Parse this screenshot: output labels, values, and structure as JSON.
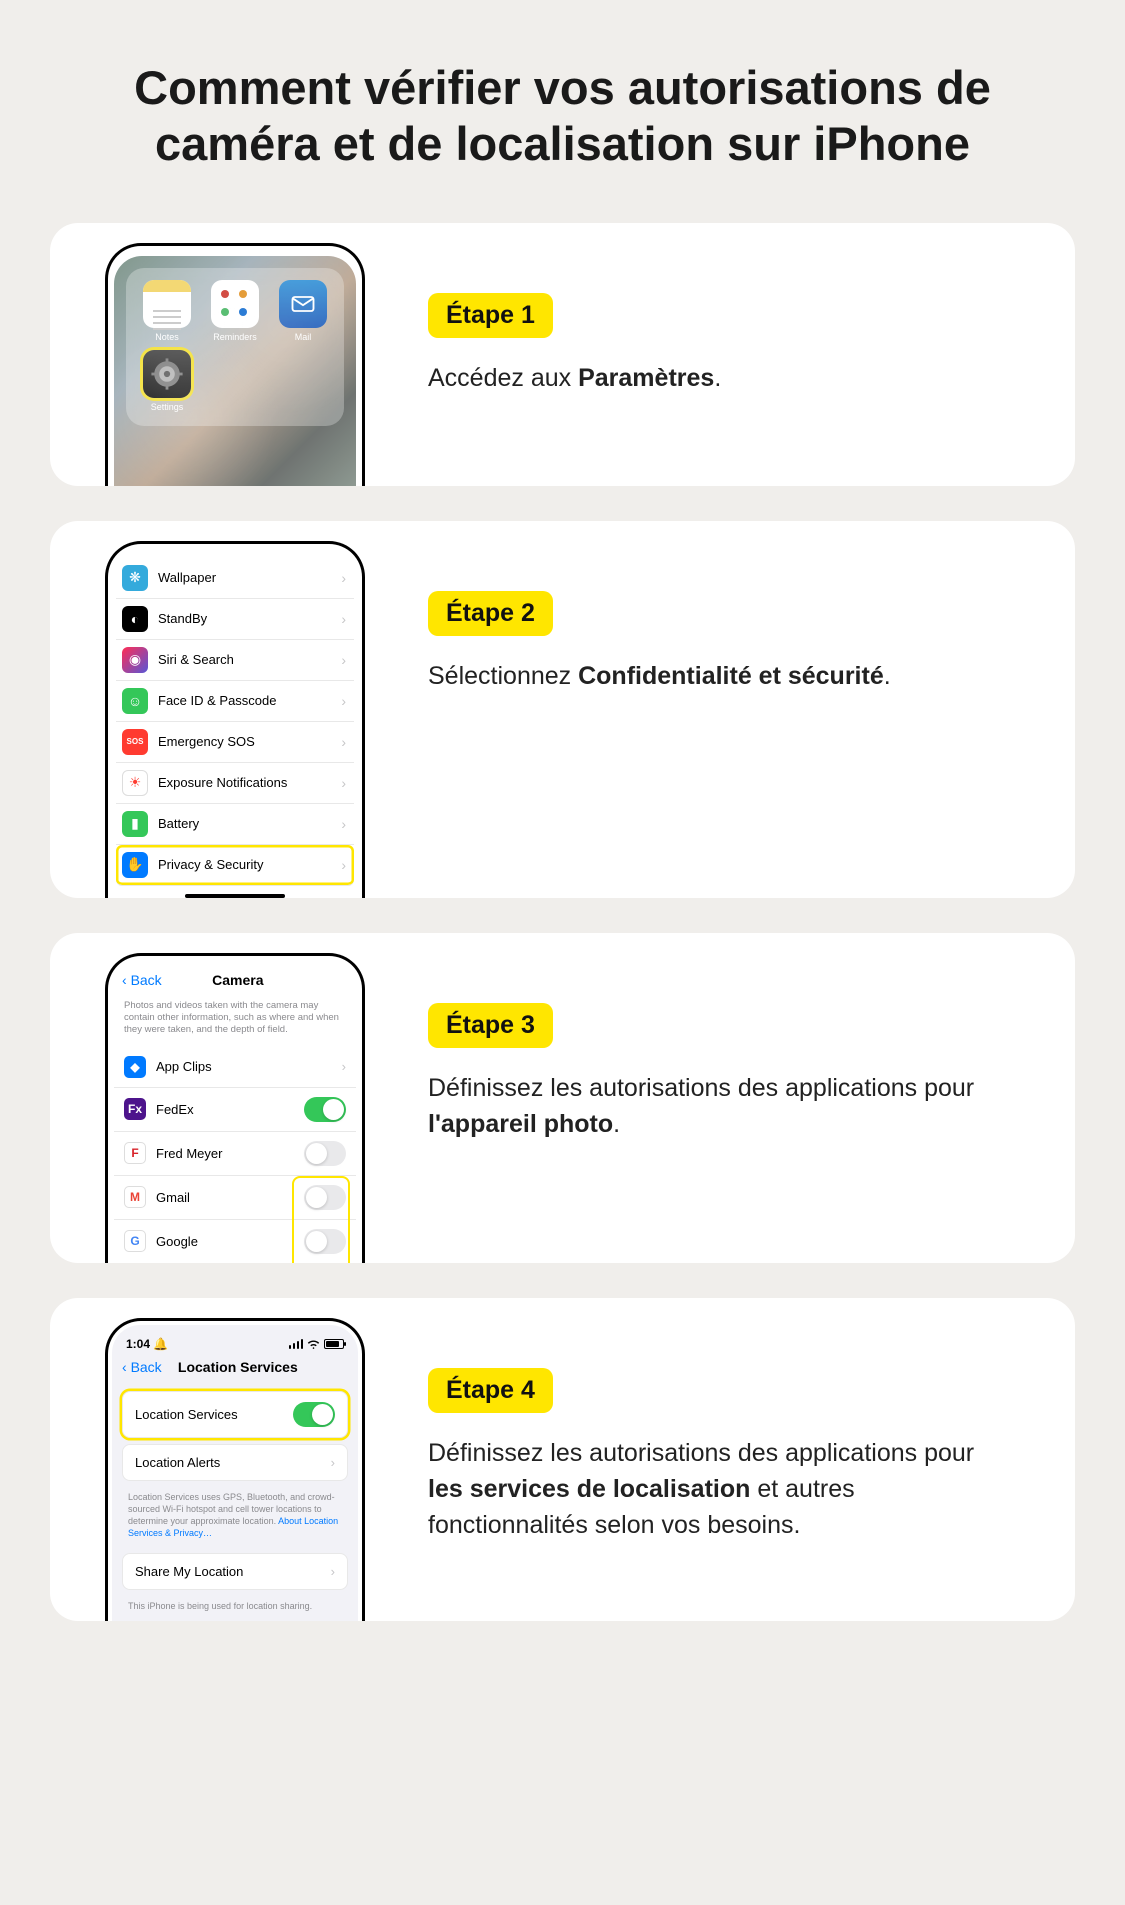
{
  "title": "Comment vérifier vos autorisations de caméra et de localisation sur iPhone",
  "steps": [
    {
      "badge": "Étape 1",
      "desc_pre": "Accédez aux ",
      "desc_bold": "Paramètres",
      "desc_post": ".",
      "home_apps": {
        "notes": "Notes",
        "reminders": "Reminders",
        "mail": "Mail",
        "settings": "Settings"
      }
    },
    {
      "badge": "Étape 2",
      "desc_pre": "Sélectionnez ",
      "desc_bold": "Confidentialité et sécurité",
      "desc_post": ".",
      "rows": [
        {
          "label": "Wallpaper",
          "color": "#34aadc",
          "glyph": "❋"
        },
        {
          "label": "StandBy",
          "color": "#000",
          "glyph": "◐"
        },
        {
          "label": "Siri & Search",
          "color": "linear-gradient(135deg,#ff2d55,#5856d6)",
          "glyph": "◉"
        },
        {
          "label": "Face ID & Passcode",
          "color": "#34c759",
          "glyph": "☺"
        },
        {
          "label": "Emergency SOS",
          "color": "#ff3b30",
          "glyph": "SOS",
          "small": true
        },
        {
          "label": "Exposure Notifications",
          "color": "#fff",
          "glyph": "☀",
          "fg": "#ff3b30",
          "border": true
        },
        {
          "label": "Battery",
          "color": "#34c759",
          "glyph": "▮"
        },
        {
          "label": "Privacy & Security",
          "color": "#007aff",
          "glyph": "✋",
          "highlight": true
        }
      ]
    },
    {
      "badge": "Étape 3",
      "desc_pre": "Définissez les autorisations des applications pour ",
      "desc_bold": "l'appareil photo",
      "desc_post": ".",
      "back": "Back",
      "title": "Camera",
      "note": "Photos and videos taken with the camera may contain other information, such as where and when they were taken, and the depth of field.",
      "apps": [
        {
          "name": "App Clips",
          "bg": "#007aff",
          "glyph": "◆",
          "chev": true
        },
        {
          "name": "FedEx",
          "bg": "#4d148c",
          "glyph": "Fx",
          "on": true
        },
        {
          "name": "Fred Meyer",
          "bg": "#fff",
          "glyph": "F",
          "fg": "#d8232a",
          "on": false
        },
        {
          "name": "Gmail",
          "bg": "#fff",
          "glyph": "M",
          "fg": "#ea4335",
          "on": false
        },
        {
          "name": "Google",
          "bg": "#fff",
          "glyph": "G",
          "fg": "#4285f4",
          "on": false
        }
      ]
    },
    {
      "badge": "Étape 4",
      "desc_pre": "Définissez les autorisations des applications pour ",
      "desc_bold": "les services de localisation",
      "desc_post": " et autres fonctionnalités selon vos besoins.",
      "time": "1:04",
      "back": "Back",
      "title": "Location Services",
      "row_loc": "Location Services",
      "row_alerts": "Location Alerts",
      "footer1_a": "Location Services uses GPS, Bluetooth, and crowd-sourced Wi-Fi hotspot and cell tower locations to determine your approximate location. ",
      "footer1_link": "About Location Services & Privacy…",
      "row_share": "Share My Location",
      "footer2": "This iPhone is being used for location sharing."
    }
  ]
}
